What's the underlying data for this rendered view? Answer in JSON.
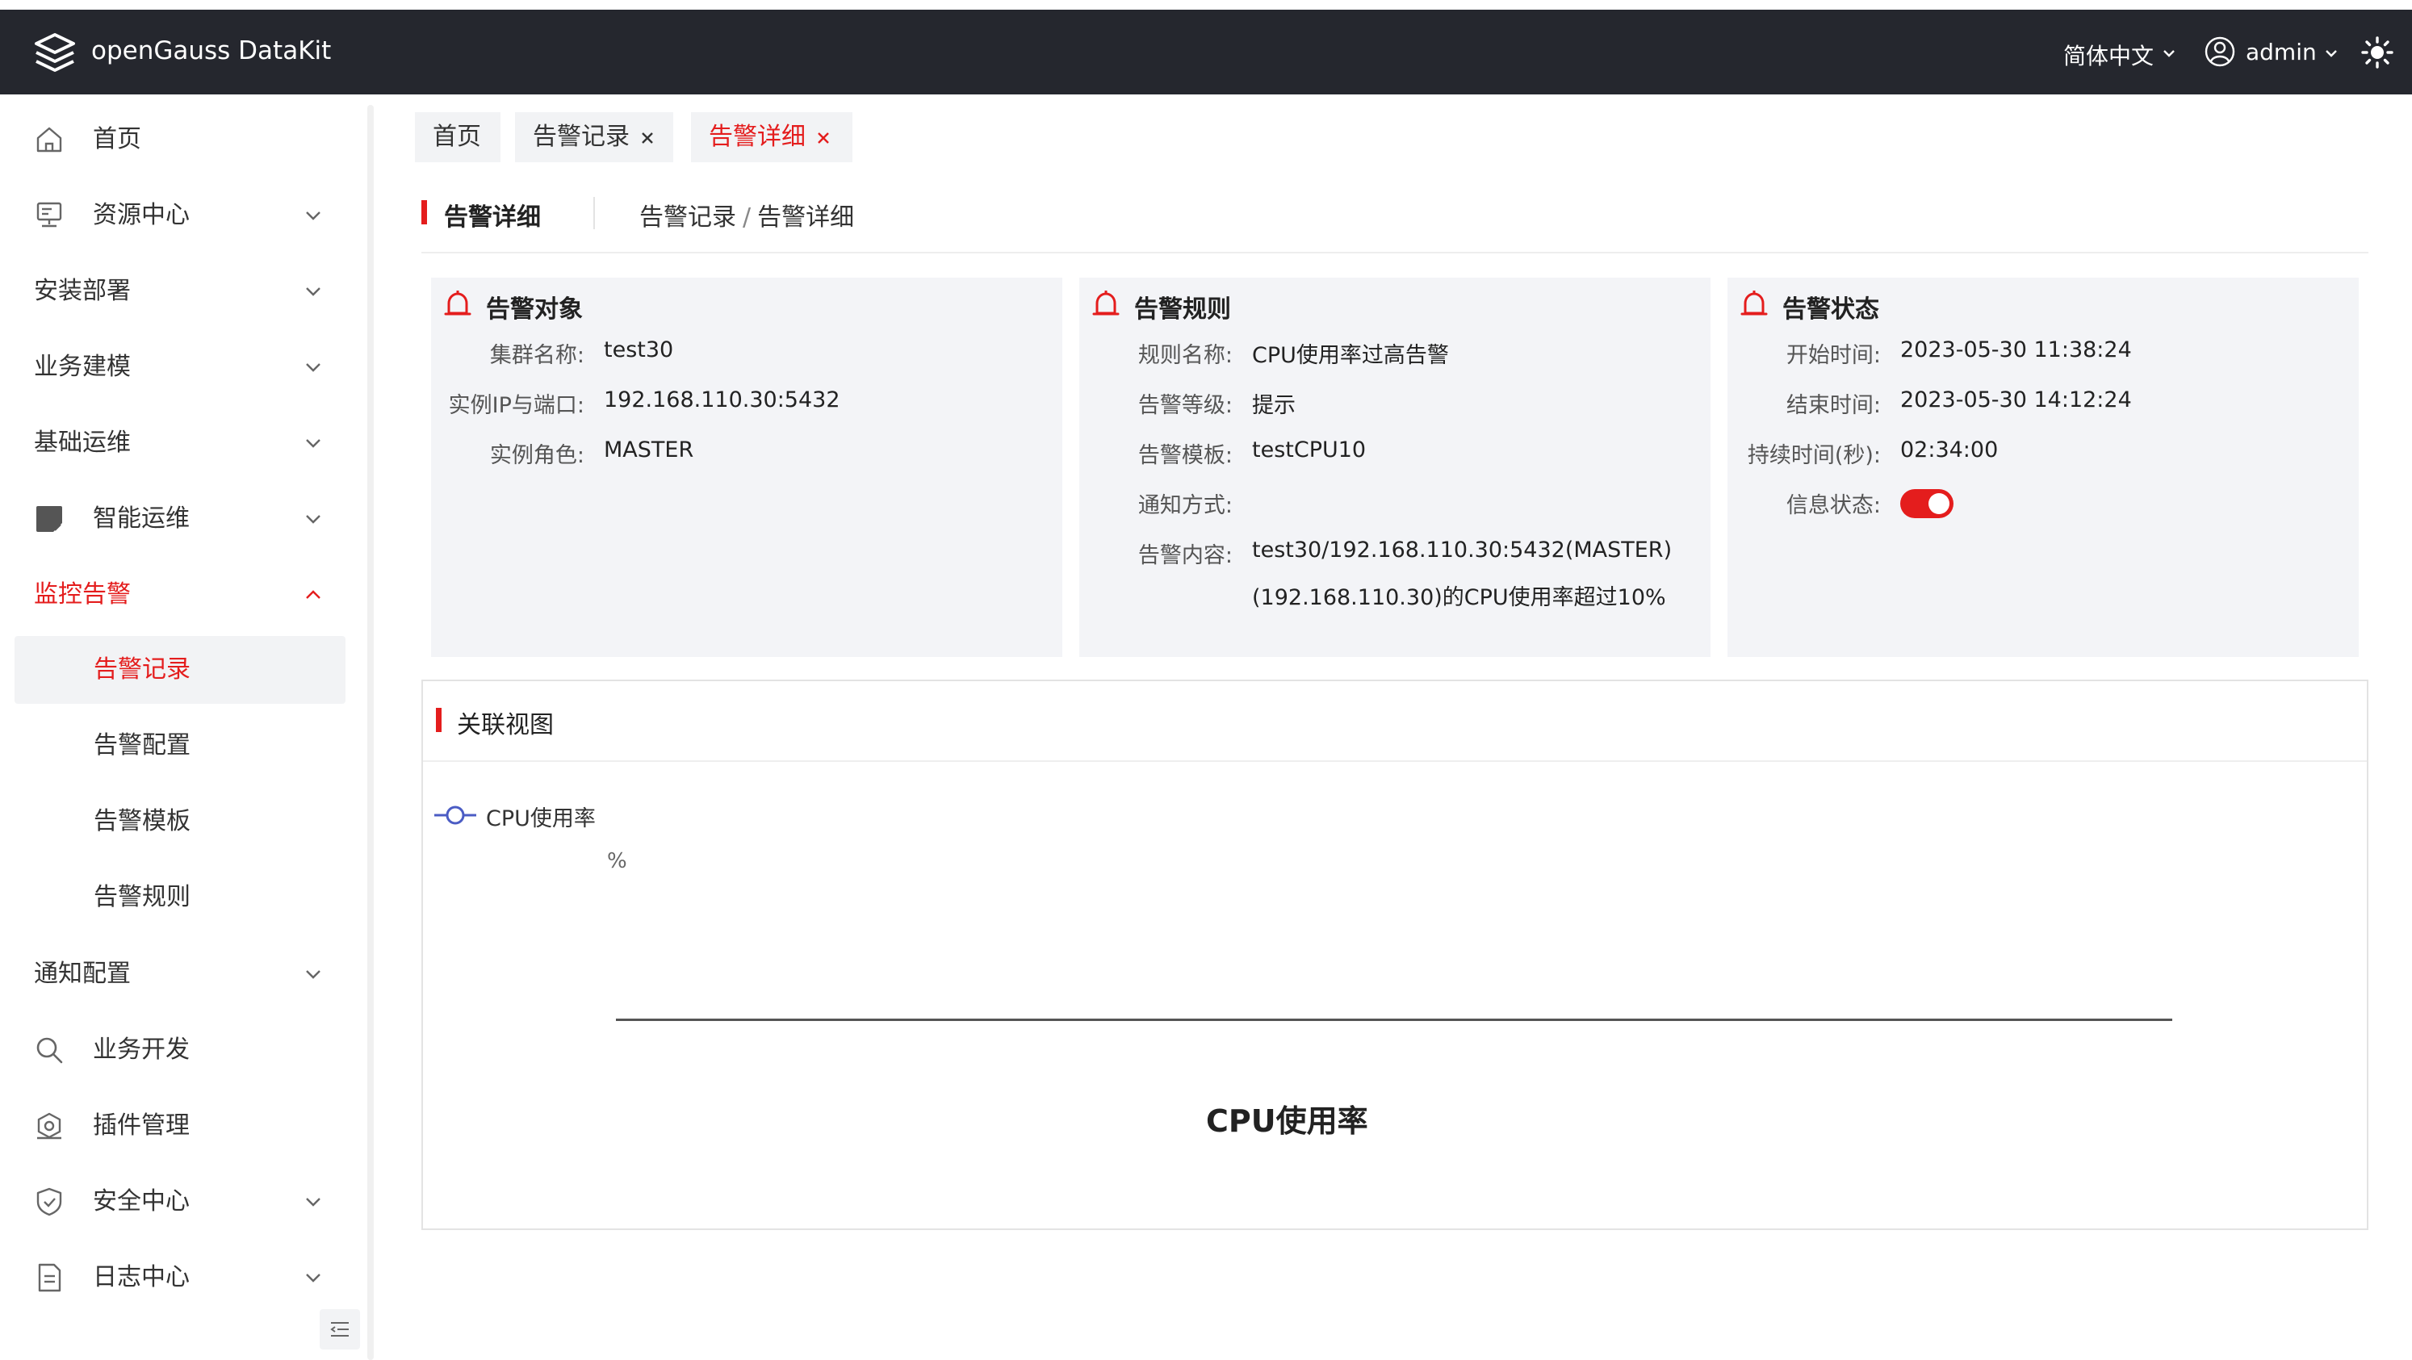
{
  "header": {
    "app_title": "openGauss DataKit",
    "language": "简体中文",
    "username": "admin",
    "logo_icon": "layers-logo-icon",
    "theme_icon": "sun-icon"
  },
  "sidebar": {
    "items": [
      {
        "label": "首页",
        "icon": "home-icon"
      },
      {
        "label": "资源中心",
        "icon": "server-icon"
      },
      {
        "label": "安装部署"
      },
      {
        "label": "业务建模"
      },
      {
        "label": "基础运维"
      },
      {
        "label": "智能运维",
        "icon": "edit-square-icon"
      },
      {
        "label": "监控告警"
      },
      {
        "label": "通知配置"
      },
      {
        "label": "业务开发",
        "icon": "search-icon"
      },
      {
        "label": "插件管理",
        "icon": "plugin-icon"
      },
      {
        "label": "安全中心",
        "icon": "shield-icon"
      },
      {
        "label": "日志中心",
        "icon": "document-icon"
      }
    ],
    "monitor_sub": [
      {
        "label": "告警记录"
      },
      {
        "label": "告警配置"
      },
      {
        "label": "告警模板"
      },
      {
        "label": "告警规则"
      }
    ]
  },
  "tabs": [
    {
      "label": "首页"
    },
    {
      "label": "告警记录"
    },
    {
      "label": "告警详细"
    }
  ],
  "page": {
    "title": "告警详细",
    "breadcrumb": [
      "告警记录",
      "告警详细"
    ],
    "breadcrumb_sep": "/"
  },
  "cards": {
    "target": {
      "title": "告警对象",
      "rows": [
        {
          "k": "集群名称:",
          "v": "test30"
        },
        {
          "k": "实例IP与端口:",
          "v": "192.168.110.30:5432"
        },
        {
          "k": "实例角色:",
          "v": "MASTER"
        }
      ]
    },
    "rule": {
      "title": "告警规则",
      "rows": [
        {
          "k": "规则名称:",
          "v": "CPU使用率过高告警"
        },
        {
          "k": "告警等级:",
          "v": "提示"
        },
        {
          "k": "告警模板:",
          "v": "testCPU10"
        },
        {
          "k": "通知方式:",
          "v": ""
        },
        {
          "k": "告警内容:",
          "v": "test30/192.168.110.30:5432(MASTER)"
        }
      ],
      "content_line2": "(192.168.110.30)的CPU使用率超过10%"
    },
    "status": {
      "title": "告警状态",
      "rows": [
        {
          "k": "开始时间:",
          "v": "2023-05-30 11:38:24"
        },
        {
          "k": "结束时间:",
          "v": "2023-05-30 14:12:24"
        },
        {
          "k": "持续时间(秒):",
          "v": "02:34:00"
        },
        {
          "k": "信息状态:",
          "v": ""
        }
      ],
      "info_status_on": true
    }
  },
  "related": {
    "title": "关联视图"
  },
  "chart_data": {
    "type": "line",
    "title": "CPU使用率",
    "ylabel": "%",
    "series": [
      {
        "name": "CPU使用率",
        "values": []
      }
    ],
    "color": "#4b5cc4"
  },
  "colors": {
    "accent": "#e41d1d",
    "header_bg": "#25272e",
    "series": "#4b5cc4"
  }
}
